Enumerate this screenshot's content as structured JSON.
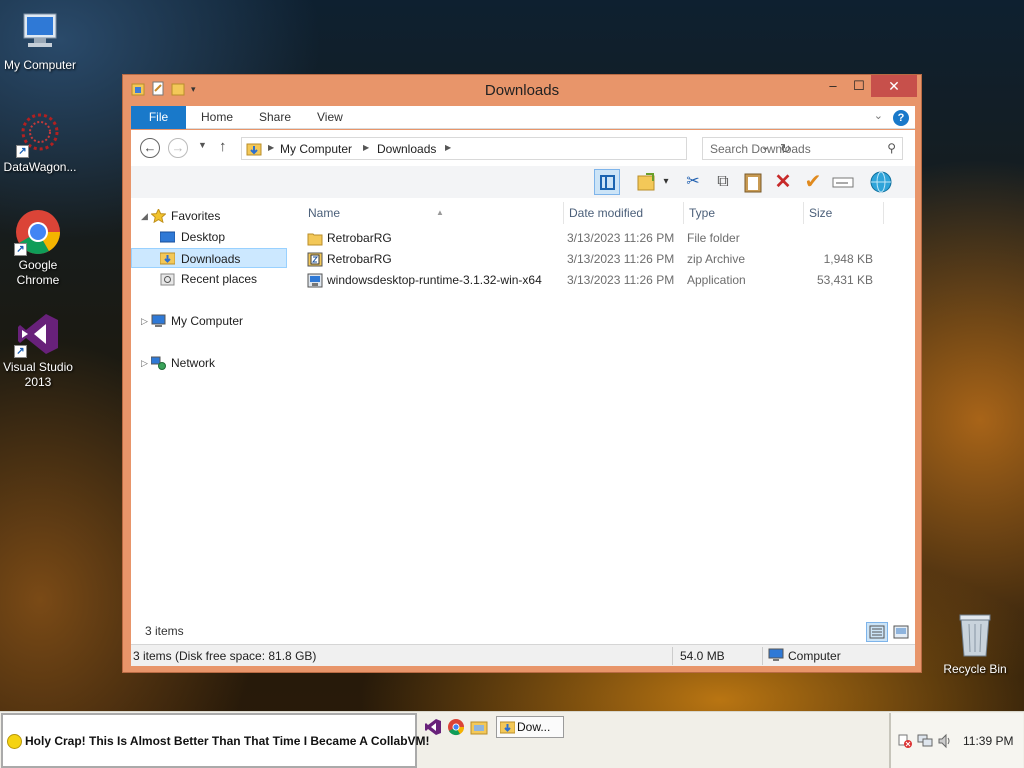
{
  "desktop": {
    "icons": [
      {
        "label": "My Computer"
      },
      {
        "label": "DataWagon..."
      },
      {
        "label": "Google Chrome"
      },
      {
        "label": "Visual Studio 2013"
      },
      {
        "label": "Recycle Bin"
      }
    ]
  },
  "window": {
    "title": "Downloads",
    "controls": {
      "minimize": "–",
      "maximize": "☐",
      "close": "✕"
    },
    "ribbon_tabs": [
      "File",
      "Home",
      "Share",
      "View"
    ],
    "address": {
      "crumbs": [
        "My Computer",
        "Downloads"
      ]
    },
    "search": {
      "placeholder": "Search Downloads"
    },
    "nav": {
      "favorites": "Favorites",
      "desktop": "Desktop",
      "downloads": "Downloads",
      "recent": "Recent places",
      "my_computer": "My Computer",
      "network": "Network"
    },
    "columns": [
      "Name",
      "Date modified",
      "Type",
      "Size"
    ],
    "files": [
      {
        "name": "RetrobarRG",
        "date": "3/13/2023 11:26 PM",
        "type": "File folder",
        "size": ""
      },
      {
        "name": "RetrobarRG",
        "date": "3/13/2023 11:26 PM",
        "type": "zip Archive",
        "size": "1,948 KB"
      },
      {
        "name": "windowsdesktop-runtime-3.1.32-win-x64",
        "date": "3/13/2023 11:26 PM",
        "type": "Application",
        "size": "53,431 KB"
      }
    ],
    "item_count": "3 items",
    "status": {
      "left": "3 items (Disk free space: 81.8 GB)",
      "size": "54.0 MB",
      "location": "Computer"
    }
  },
  "taskbar": {
    "ticker": "Holy Crap! This Is Almost Better Than That Time I Became A CollabVM!",
    "active_task": "Dow...",
    "clock": "11:39 PM"
  },
  "colors": {
    "titlebar": "#e8956a",
    "accent": "#1979ca",
    "close": "#c7504b",
    "selection": "#cce8ff"
  }
}
